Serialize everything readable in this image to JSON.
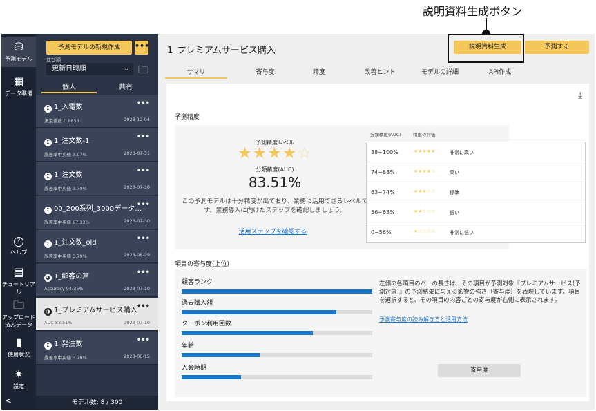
{
  "annotation": {
    "label": "説明資料生成ボタン"
  },
  "nav": {
    "items": [
      {
        "icon": "prediction-model-icon",
        "glyph": "⛁",
        "label": "予測モデル"
      },
      {
        "icon": "data-prep-icon",
        "glyph": "▦",
        "label": "データ準備"
      },
      {
        "icon": "help-icon",
        "glyph": "?",
        "label": "ヘルプ"
      },
      {
        "icon": "tutorial-icon",
        "glyph": "▤",
        "label": "チュートリアル"
      },
      {
        "icon": "upload-icon",
        "glyph": "🗀",
        "label": "アップロード済みデータ"
      },
      {
        "icon": "usage-icon",
        "glyph": "▮",
        "label": "使用状況"
      },
      {
        "icon": "settings-icon",
        "glyph": "✷",
        "label": "設定"
      }
    ],
    "collapse": "<"
  },
  "list": {
    "new_button": "予測モデルの新規作成",
    "more": "•••",
    "sort_label": "並び順",
    "sort_value": "更新日時順",
    "tabs": [
      "個人",
      "共有"
    ],
    "models": [
      {
        "name": "1_入電数",
        "meta": "決定係数 0.8833",
        "date": "2023-12-04",
        "icon": "Σ"
      },
      {
        "name": "1_注文数-1",
        "meta": "誤差率中央値 3.97%",
        "date": "2023-07-31",
        "icon": "Σ"
      },
      {
        "name": "1_注文数",
        "meta": "誤差率中央値 3.79%",
        "date": "2023-07-30",
        "icon": "Σ"
      },
      {
        "name": "00_200系列_3000データ…",
        "meta": "誤差率中央値 67.33%",
        "date": "2023-07-30",
        "icon": "Σ"
      },
      {
        "name": "1_注文数_old",
        "meta": "誤差率中央値 3.79%",
        "date": "2023-06-29",
        "icon": "Σ"
      },
      {
        "name": "1_顧客の声",
        "meta": "Accuracy 94.35%",
        "date": "2023-07-10",
        "icon": "◕"
      },
      {
        "name": "1_プレミアムサービス購入",
        "meta": "AUC 83.51%",
        "date": "2023-07-10",
        "icon": "◑"
      },
      {
        "name": "1_発注数",
        "meta": "誤差率中央値 3.79%",
        "date": "2023-06-15",
        "icon": "Σ"
      }
    ],
    "count": "モデル数: 8 / 300"
  },
  "main": {
    "title": "1_プレミアムサービス購入",
    "report_button": "説明資料生成",
    "predict_button": "予測する",
    "tabs": [
      "サマリ",
      "寄与度",
      "精度",
      "改善ヒント",
      "モデルの詳細",
      "API作成"
    ]
  },
  "accuracy": {
    "section_title": "予測精度",
    "level_label": "予測精度レベル",
    "stars": "★★★★",
    "stars_empty": "☆",
    "auc_label": "分類精度(AUC)",
    "auc_value": "83.51%",
    "description": "この予測モデルは十分精度が出ており、業務に活用できるレベルです。業務導入に向けたステップを確認しましょう。",
    "link": "活用ステップを確認する",
    "table_headers": [
      "分類精度(AUC)",
      "精度の評価"
    ],
    "rows": [
      {
        "range": "88~100%",
        "stars": "★★★★★",
        "eval": "非常に高い"
      },
      {
        "range": "74~88%",
        "stars": "★★★★☆",
        "eval": "高い"
      },
      {
        "range": "63~74%",
        "stars": "★★★☆☆",
        "eval": "標準"
      },
      {
        "range": "56~63%",
        "stars": "★★☆☆☆",
        "eval": "低い"
      },
      {
        "range": "0~56%",
        "stars": "★☆☆☆☆",
        "eval": "非常に低い"
      }
    ]
  },
  "contribution": {
    "section_title": "項目の寄与度(上位)",
    "items": [
      {
        "label": "顧客ランク",
        "value": 1.0
      },
      {
        "label": "過去購入額",
        "value": 0.81
      },
      {
        "label": "クーポン利用回数",
        "value": 0.69
      },
      {
        "label": "年齢",
        "value": 0.41
      },
      {
        "label": "入会時期",
        "value": 0.31
      }
    ],
    "description": "左側の各項目のバーの長さは、その項目が予測対象『プレミアムサービス(予測対象)』の予測結果に与える影響の強さ（寄与度）を表現しています。項目を選択すると、その項目の内容ごとの寄与度が右側に表示されます。",
    "link": "予測寄与度の読み解き方と活用方法",
    "button": "寄与度"
  }
}
